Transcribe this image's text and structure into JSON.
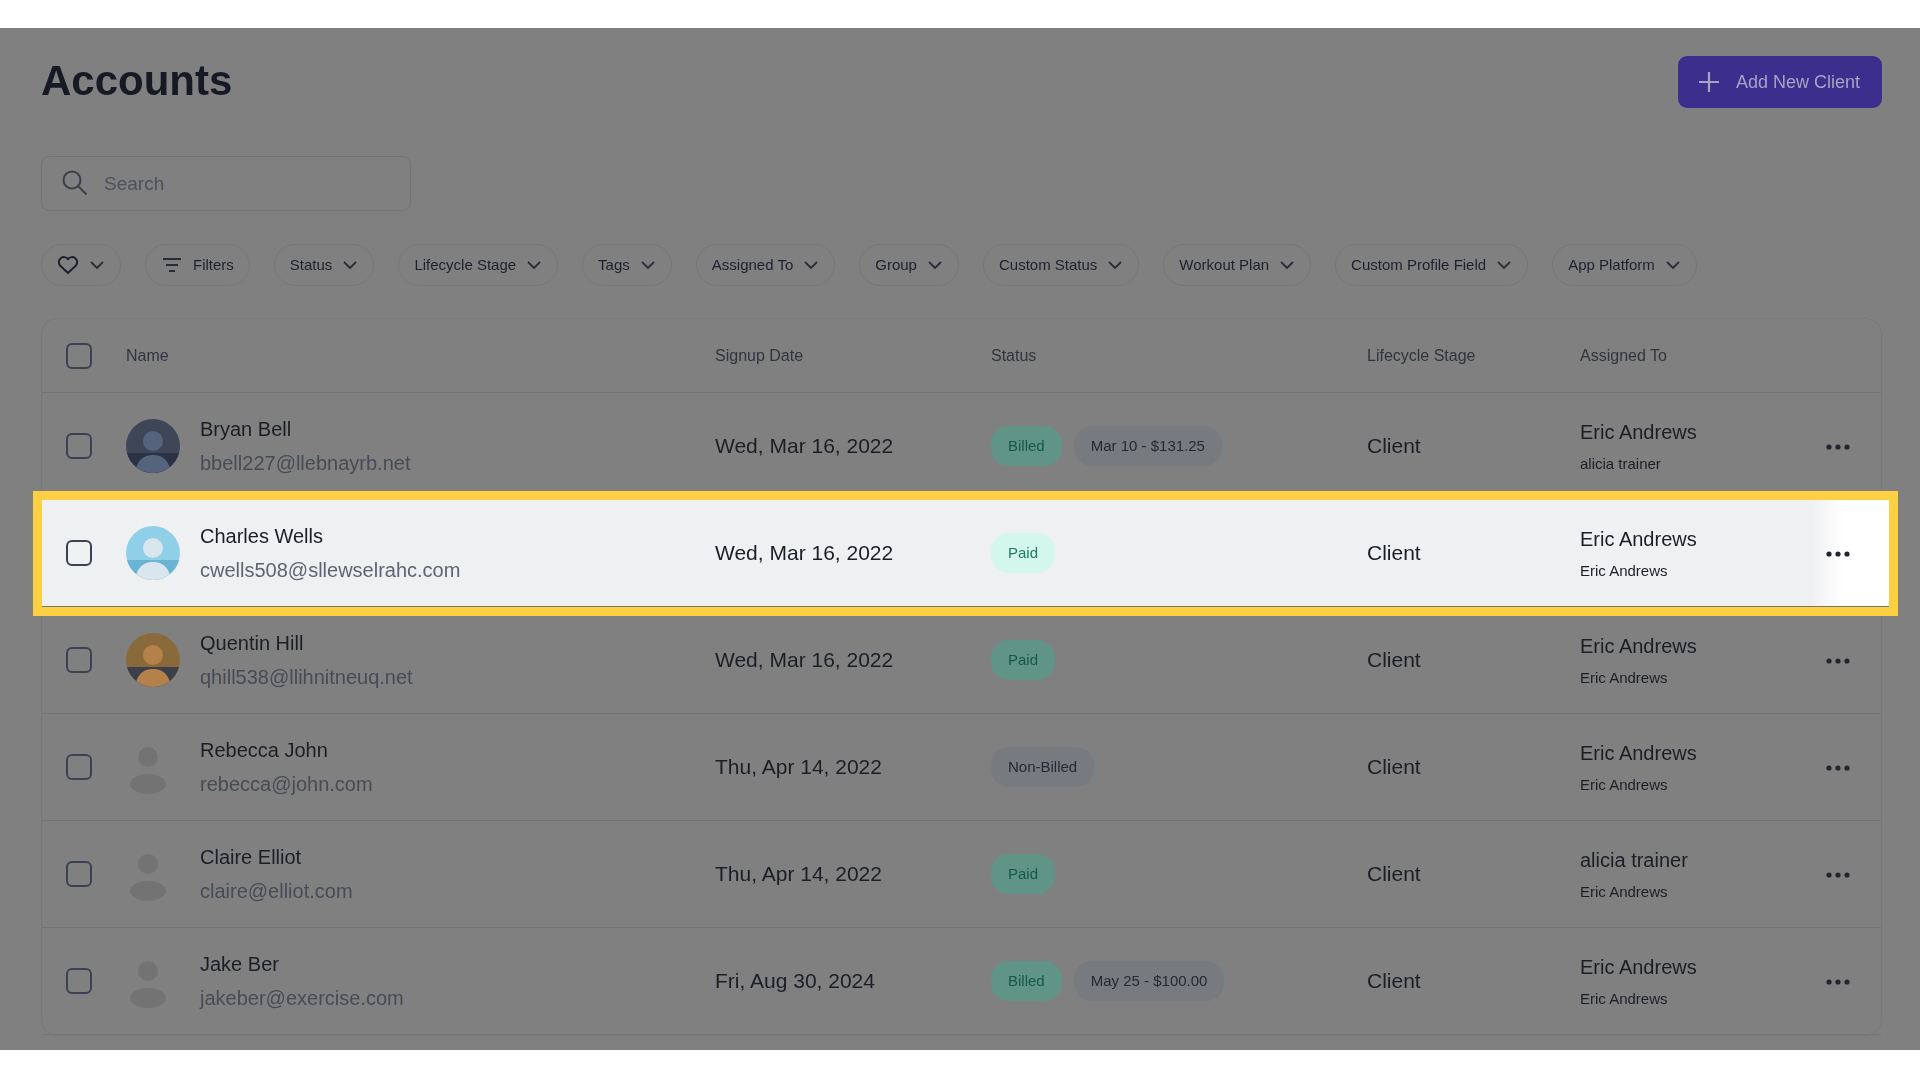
{
  "title": "Accounts",
  "add_button": {
    "label": "Add New Client"
  },
  "search": {
    "placeholder": "Search"
  },
  "filters": [
    {
      "kind": "favorites"
    },
    {
      "kind": "filters",
      "label": "Filters"
    },
    {
      "kind": "dropdown",
      "label": "Status"
    },
    {
      "kind": "dropdown",
      "label": "Lifecycle Stage"
    },
    {
      "kind": "dropdown",
      "label": "Tags"
    },
    {
      "kind": "dropdown",
      "label": "Assigned To"
    },
    {
      "kind": "dropdown",
      "label": "Group"
    },
    {
      "kind": "dropdown",
      "label": "Custom Status"
    },
    {
      "kind": "dropdown",
      "label": "Workout Plan"
    },
    {
      "kind": "dropdown",
      "label": "Custom Profile Field"
    },
    {
      "kind": "dropdown",
      "label": "App Platform"
    }
  ],
  "table": {
    "select_all": {
      "checked": false
    },
    "columns": [
      "Name",
      "Signup Date",
      "Status",
      "Lifecycle Stage",
      "Assigned To"
    ],
    "rows": [
      {
        "name": "Bryan Bell",
        "email": "bbell227@llebnayrb.net",
        "signup": "Wed, Mar 16, 2022",
        "status": {
          "kind": "billed",
          "label": "Billed"
        },
        "billing": "Mar 10 - $131.25",
        "stage": "Client",
        "assigned": "Eric Andrews",
        "assigned_secondary": "alicia trainer",
        "checked": false,
        "highlighted": false
      },
      {
        "name": "Charles Wells",
        "email": "cwells508@sllewselrahc.com",
        "signup": "Wed, Mar 16, 2022",
        "status": {
          "kind": "paid",
          "label": "Paid"
        },
        "stage": "Client",
        "assigned": "Eric Andrews",
        "assigned_secondary": "Eric Andrews",
        "checked": false,
        "highlighted": true
      },
      {
        "name": "Quentin Hill",
        "email": "qhill538@llihnitneuq.net",
        "signup": "Wed, Mar 16, 2022",
        "status": {
          "kind": "paid",
          "label": "Paid"
        },
        "stage": "Client",
        "assigned": "Eric Andrews",
        "assigned_secondary": "Eric Andrews",
        "checked": false,
        "highlighted": false
      },
      {
        "name": "Rebecca John",
        "email": "rebecca@john.com",
        "avatar": {
          "kind": "placeholder"
        },
        "signup": "Thu, Apr 14, 2022",
        "status": {
          "kind": "non-billed",
          "label": "Non-Billed"
        },
        "stage": "Client",
        "assigned": "Eric Andrews",
        "assigned_secondary": "Eric Andrews",
        "checked": false,
        "highlighted": false
      },
      {
        "name": "Claire Elliot",
        "email": "claire@elliot.com",
        "avatar": {
          "kind": "placeholder"
        },
        "signup": "Thu, Apr 14, 2022",
        "status": {
          "kind": "paid",
          "label": "Paid"
        },
        "stage": "Client",
        "assigned": "alicia trainer",
        "assigned_secondary": "Eric Andrews",
        "checked": false,
        "highlighted": false
      },
      {
        "name": "Jake Ber",
        "email": "jakeber@exercise.com",
        "avatar": {
          "kind": "placeholder"
        },
        "signup": "Fri, Aug 30, 2024",
        "status": {
          "kind": "billed",
          "label": "Billed"
        },
        "billing": "May 25 - $100.00",
        "stage": "Client",
        "assigned": "Eric Andrews",
        "assigned_secondary": "Eric Andrews",
        "checked": false,
        "highlighted": false
      }
    ]
  }
}
